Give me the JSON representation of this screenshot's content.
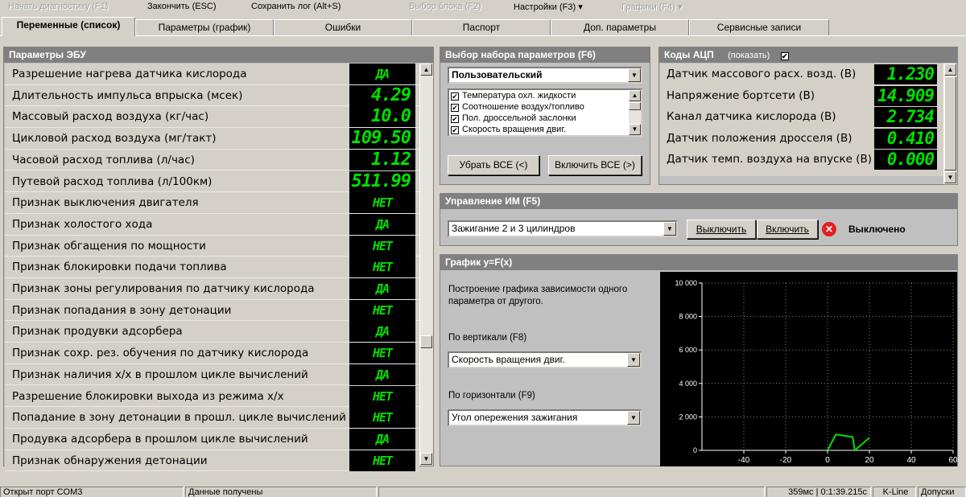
{
  "menu": {
    "start_diag": "Начать диагностику (F1)",
    "finish": "Закончить (ESC)",
    "save_log": "Сохранить лог (Alt+S)",
    "block_select": "Выбор блока (F2)",
    "settings": "Настройки (F3) ▾",
    "graphs": "Графики (F4) ▾"
  },
  "tabs": [
    "Переменные (список)",
    "Параметры (график)",
    "Ошибки",
    "Паспорт",
    "Доп. параметры",
    "Сервисные записи"
  ],
  "ecu": {
    "title": "Параметры ЭБУ",
    "rows": [
      {
        "label": "Разрешение нагрева датчика кислорода",
        "value": "ДА"
      },
      {
        "label": "Длительность импульса впрыска (мсек)",
        "value": "4.29"
      },
      {
        "label": "Массовый расход воздуха (кг/час)",
        "value": "10.0"
      },
      {
        "label": "Цикловой расход воздуха (мг/такт)",
        "value": "109.50"
      },
      {
        "label": "Часовой расход топлива (л/час)",
        "value": "1.12"
      },
      {
        "label": "Путевой расход топлива (л/100км)",
        "value": "511.99"
      },
      {
        "label": "Признак выключения двигателя",
        "value": "НЕТ"
      },
      {
        "label": "Признак холостого хода",
        "value": "ДА"
      },
      {
        "label": "Признак обгащения по мощности",
        "value": "НЕТ"
      },
      {
        "label": "Признак блокировки подачи топлива",
        "value": "НЕТ"
      },
      {
        "label": "Признак зоны регулирования по датчику кислорода",
        "value": "ДА"
      },
      {
        "label": "Признак попадания в зону детонации",
        "value": "НЕТ"
      },
      {
        "label": "Признак продувки адсорбера",
        "value": "ДА"
      },
      {
        "label": "Признак сохр. рез. обучения по датчику кислорода",
        "value": "НЕТ"
      },
      {
        "label": "Признак наличия х/х в прошлом цикле вычислений",
        "value": "ДА"
      },
      {
        "label": "Разрешение блокировки выхода из режима х/х",
        "value": "НЕТ"
      },
      {
        "label": "Попадание в зону детонации в прошл. цикле вычислений",
        "value": "НЕТ"
      },
      {
        "label": "Продувка адсорбера в прошлом цикле вычислений",
        "value": "ДА"
      },
      {
        "label": "Признак обнаружения детонации",
        "value": "НЕТ"
      }
    ]
  },
  "paramset": {
    "title": "Выбор набора параметров (F6)",
    "selected": "Пользовательский",
    "items": [
      "Температура охл. жидкости",
      "Соотношение воздух/топливо",
      "Пол. дроссельной заслонки",
      "Скорость вращения двиг."
    ],
    "remove_all": "Убрать ВСЕ (<)",
    "enable_all": "Включить ВСЕ (>)"
  },
  "adc": {
    "title": "Коды АЦП",
    "show_label": "(показать)",
    "check": "✔",
    "rows": [
      {
        "label": "Датчик массового расх. возд. (В)",
        "value": "1.230"
      },
      {
        "label": "Напряжение бортсети (В)",
        "value": "14.909"
      },
      {
        "label": "Канал датчика кислорода (В)",
        "value": "2.734"
      },
      {
        "label": "Датчик положения дросселя (В)",
        "value": "0.410"
      },
      {
        "label": "Датчик темп. воздуха на впуске (В)",
        "value": "0.000"
      }
    ]
  },
  "actuator": {
    "title": "Управление ИМ (F5)",
    "selected": "Зажигание 2 и 3 цилиндров",
    "off_btn": "Выключить",
    "on_btn": "Включить",
    "status": "Выключено",
    "status_color": "#e02020"
  },
  "graph": {
    "title": "График y=F(x)",
    "description": "Построение графика зависимости одного параметра от другого.",
    "vertical_label": "По вертикали (F8)",
    "vertical_value": "Скорость вращения двиг.",
    "horizontal_label": "По горизонтали (F9)",
    "horizontal_value": "Угол опережения зажигания"
  },
  "chart_data": {
    "type": "line",
    "x": [
      0,
      4,
      12,
      13,
      20
    ],
    "series": [
      {
        "values": [
          0,
          950,
          800,
          0,
          750
        ],
        "color": "#00e000"
      }
    ],
    "xlim": [
      -60,
      60
    ],
    "ylim": [
      0,
      10000
    ],
    "xticks": [
      "-40",
      "-20",
      "0",
      "20",
      "40",
      "60"
    ],
    "xtick_values": [
      -40,
      -20,
      0,
      20,
      40,
      60
    ],
    "yticks": [
      "0",
      "2 000",
      "4 000",
      "6 000",
      "8 000",
      "10 000"
    ],
    "ytick_values": [
      0,
      2000,
      4000,
      6000,
      8000,
      10000
    ],
    "grid": true
  },
  "status": {
    "port": "Открыт порт COM3",
    "data": "Данные получены",
    "timing": "359мс | 0:1:39.215с",
    "kline": "K-Line",
    "tolerances": "Допуски"
  }
}
